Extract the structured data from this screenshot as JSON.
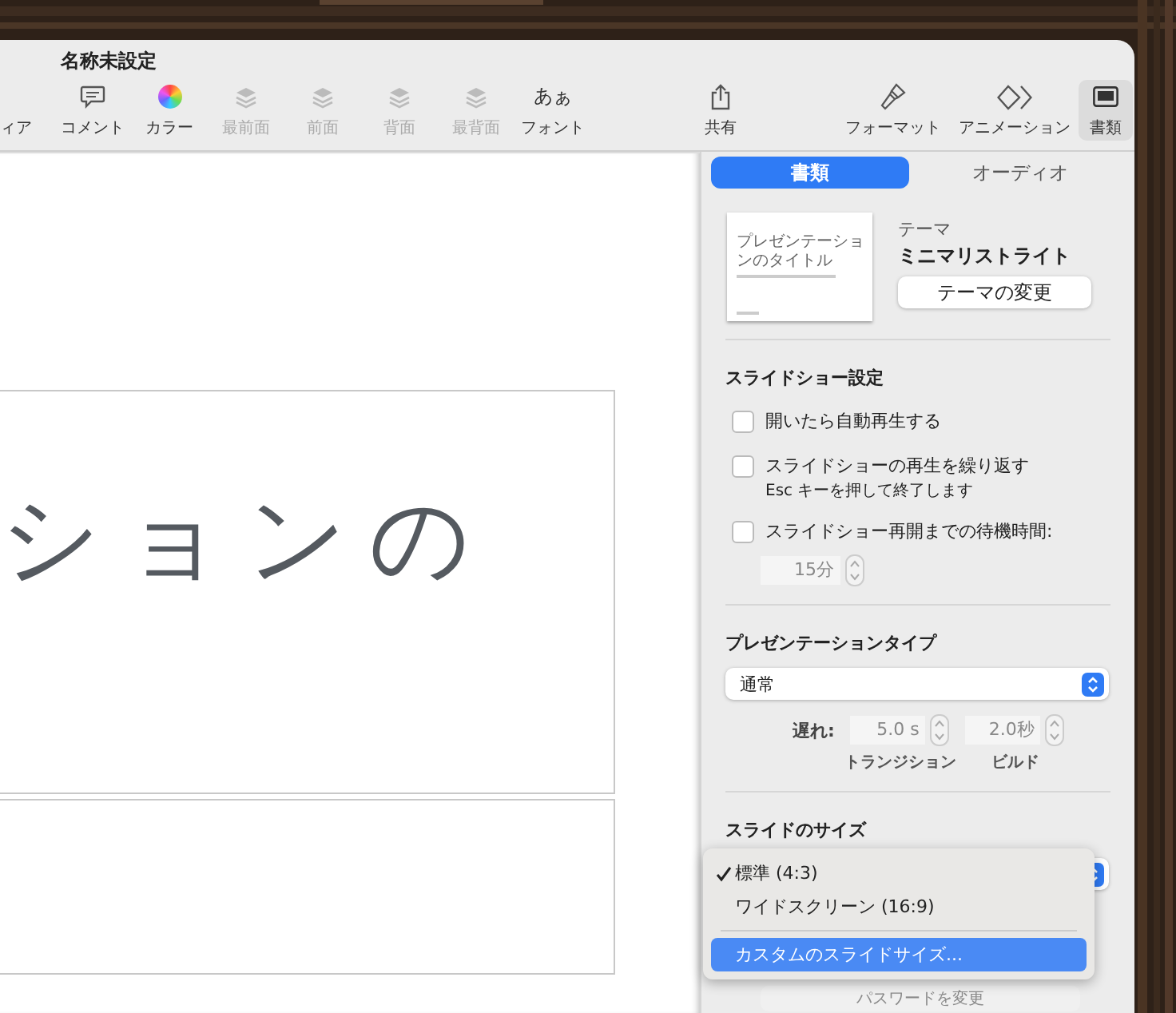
{
  "window": {
    "title": "名称未設定"
  },
  "toolbar": [
    {
      "label": "ィア",
      "kind": "none",
      "disabled": false,
      "selected": false
    },
    {
      "label": "コメント",
      "kind": "comment",
      "disabled": false,
      "selected": false
    },
    {
      "label": "カラー",
      "kind": "color",
      "disabled": false,
      "selected": false
    },
    {
      "label": "最前面",
      "kind": "layers",
      "disabled": true,
      "selected": false
    },
    {
      "label": "前面",
      "kind": "layers",
      "disabled": true,
      "selected": false
    },
    {
      "label": "背面",
      "kind": "layers",
      "disabled": true,
      "selected": false
    },
    {
      "label": "最背面",
      "kind": "layers",
      "disabled": true,
      "selected": false
    },
    {
      "label": "フォント",
      "kind": "font",
      "icon_text": "あぁ",
      "disabled": false,
      "selected": false
    },
    {
      "label": "共有",
      "kind": "share",
      "disabled": false,
      "selected": false
    },
    {
      "label": "フォーマット",
      "kind": "brush",
      "disabled": false,
      "selected": false
    },
    {
      "label": "アニメーション",
      "kind": "diamond",
      "disabled": false,
      "selected": false
    },
    {
      "label": "書類",
      "kind": "document",
      "disabled": false,
      "selected": true
    }
  ],
  "slide": {
    "title": "ションの"
  },
  "inspector": {
    "tabs": [
      {
        "label": "書類",
        "selected": true
      },
      {
        "label": "オーディオ",
        "selected": false
      }
    ],
    "theme": {
      "thumbnail_title": "プレゼンテーションのタイトル",
      "label": "テーマ",
      "name": "ミニマリストライト",
      "button": "テーマの変更"
    },
    "slideshow": {
      "heading": "スライドショー設定",
      "options": [
        {
          "label": "開いたら自動再生する",
          "checked": false
        },
        {
          "label": "スライドショーの再生を繰り返す",
          "checked": false,
          "note": "Esc キーを押して終了します"
        },
        {
          "label": "スライドショー再開までの待機時間:",
          "checked": false
        }
      ],
      "wait_value": "15分"
    },
    "presentation_type": {
      "heading": "プレゼンテーションタイプ",
      "value": "通常",
      "delay_label": "遅れ:",
      "transition_value": "5.0 s",
      "transition_label": "トランジション",
      "build_value": "2.0秒",
      "build_label": "ビルド"
    },
    "slide_size": {
      "heading": "スライドのサイズ",
      "menu": [
        {
          "label": "標準 (4:3)",
          "checked": true,
          "selected": false
        },
        {
          "label": "ワイドスクリーン (16:9)",
          "checked": false,
          "selected": false
        },
        {
          "label": "カスタムのスライドサイズ...",
          "checked": false,
          "selected": true
        }
      ],
      "password_button": {
        "label": "パスワードを変更",
        "disabled": true
      }
    }
  }
}
